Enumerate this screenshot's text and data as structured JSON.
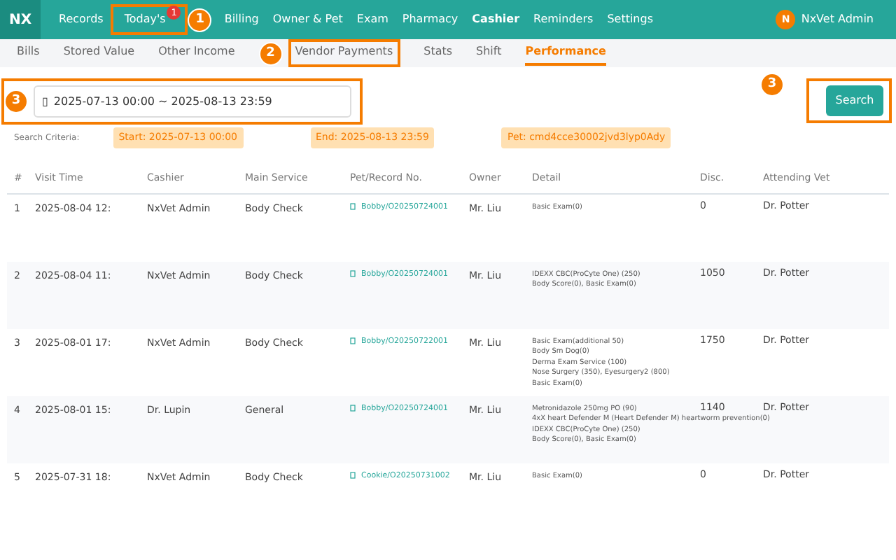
{
  "brand": "NX",
  "nav": [
    {
      "label": "Records",
      "selected": false
    },
    {
      "label": "Today's",
      "selected": false,
      "badge": "1"
    },
    {
      "label": "Billing",
      "selected": false
    },
    {
      "label": "Owner & Pet",
      "selected": false
    },
    {
      "label": "Exam",
      "selected": false
    },
    {
      "label": "Pharmacy",
      "selected": false
    },
    {
      "label": "Cashier",
      "selected": true
    },
    {
      "label": "Reminders",
      "selected": false
    },
    {
      "label": "Settings",
      "selected": false
    }
  ],
  "user": {
    "initial": "N",
    "name": "NxVet Admin"
  },
  "subtabs": [
    {
      "label": "Bills",
      "selected": false
    },
    {
      "label": "Stored Value",
      "selected": false
    },
    {
      "label": "Other Income",
      "selected": false
    },
    {
      "label": "Vendor Payments",
      "selected": false
    },
    {
      "label": "Stats",
      "selected": false
    },
    {
      "label": "Shift",
      "selected": false
    },
    {
      "label": "Performance",
      "selected": true
    }
  ],
  "date_range": {
    "icon_char": "▯",
    "value": "2025-07-13 00:00 ~ 2025-08-13 23:59"
  },
  "search_button": "Search",
  "criteria": {
    "label": "Search Criteria:",
    "tags": [
      "Start: 2025-07-13 00:00",
      "End: 2025-08-13 23:59",
      "Pet: cmd4cce30002jvd3lyp0Ady"
    ]
  },
  "table": {
    "columns": [
      "#",
      "Visit Time",
      "Cashier",
      "Main Service",
      "Pet/Record No.",
      "Owner",
      "Detail",
      "Disc.",
      "Attending Vet"
    ],
    "rows": [
      {
        "cells": [
          "1",
          "2025-08-04 12:",
          "NxVet Admin",
          "Body Check",
          "Bobby/O20250724001",
          "Mr. Liu"
        ],
        "detail": [
          "Basic Exam(0)"
        ],
        "disc": "0",
        "vet": "Dr. Potter"
      },
      {
        "cells": [
          "2",
          "2025-08-04 11:",
          "NxVet Admin",
          "Body Check",
          "Bobby/O20250724001",
          "Mr. Liu"
        ],
        "detail": [
          "IDEXX CBC(ProCyte One) (250)",
          "Body Score(0), Basic Exam(0)"
        ],
        "disc": "1050",
        "vet": "Dr. Potter"
      },
      {
        "cells": [
          "3",
          "2025-08-01 17:",
          "NxVet Admin",
          "Body Check",
          "Bobby/O20250722001",
          "Mr. Liu"
        ],
        "detail": [
          "Basic Exam(additional 50)",
          "Body Sm Dog(0)",
          "Derma Exam Service (100)",
          "Nose Surgery (350), Eyesurgery2 (800)",
          "Basic Exam(0)"
        ],
        "disc": "1750",
        "vet": "Dr. Potter"
      },
      {
        "cells": [
          "4",
          "2025-08-01 15:",
          "Dr. Lupin",
          "General",
          "Bobby/O20250724001",
          "Mr. Liu"
        ],
        "detail": [
          "Metronidazole 250mg PO (90)",
          "4xX heart Defender M (Heart Defender M) heartworm prevention(0)",
          "IDEXX CBC(ProCyte One) (250)",
          "Body Score(0), Basic Exam(0)"
        ],
        "disc": "1140",
        "vet": "Dr. Potter"
      },
      {
        "cells": [
          "5",
          "2025-07-31 18:",
          "NxVet Admin",
          "Body Check",
          "Cookie/O20250731002",
          "Mr. Liu"
        ],
        "detail": [
          "Basic Exam(0)"
        ],
        "disc": "0",
        "vet": "Dr. Potter"
      }
    ]
  },
  "callouts": [
    "1",
    "2",
    "3",
    "3"
  ]
}
